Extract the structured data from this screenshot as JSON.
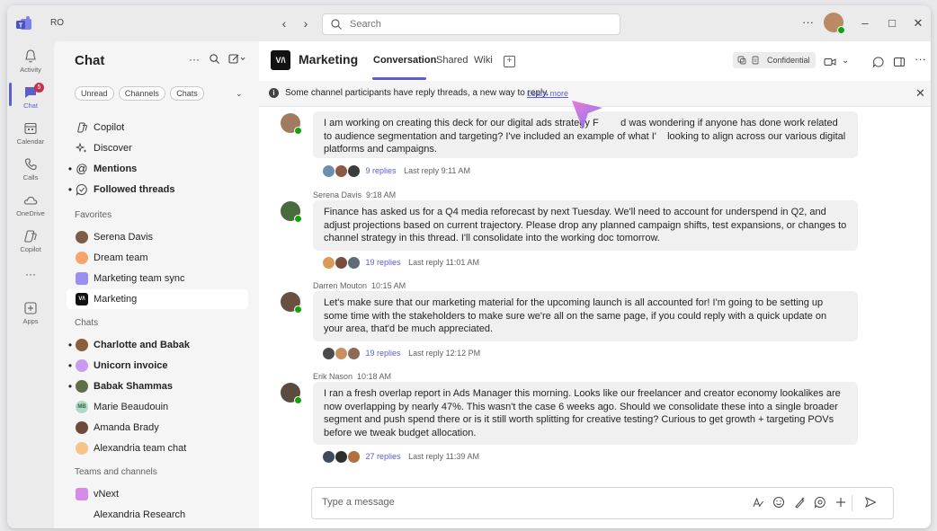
{
  "titlebar": {
    "org_label": "RO",
    "search_placeholder": "Search",
    "more": "···"
  },
  "rail": {
    "items": [
      {
        "label": "Activity"
      },
      {
        "label": "Chat",
        "badge": "5"
      },
      {
        "label": "Calendar"
      },
      {
        "label": "Calls"
      },
      {
        "label": "OneDrive"
      },
      {
        "label": "Copilot"
      },
      {
        "label": "···"
      },
      {
        "label": "Apps"
      }
    ]
  },
  "chatlist": {
    "title": "Chat",
    "filters": [
      "Unread",
      "Channels",
      "Chats"
    ],
    "top_items": [
      {
        "label": "Copilot",
        "icon": "copilot-icon"
      },
      {
        "label": "Discover",
        "icon": "sparkle-icon"
      },
      {
        "label": "Mentions",
        "icon": "at-icon"
      },
      {
        "label": "Followed threads",
        "icon": "threads-icon"
      }
    ],
    "favorites_header": "Favorites",
    "favorites": [
      {
        "label": "Serena Davis"
      },
      {
        "label": "Dream team"
      },
      {
        "label": "Marketing team sync"
      },
      {
        "label": "Marketing"
      }
    ],
    "chats_header": "Chats",
    "chats": [
      {
        "label": "Charlotte and Babak"
      },
      {
        "label": "Unicorn invoice"
      },
      {
        "label": "Babak Shammas"
      },
      {
        "label": "Marie Beaudouin",
        "initials": "MB"
      },
      {
        "label": "Amanda Brady"
      },
      {
        "label": "Alexandria team chat"
      }
    ],
    "teams_header": "Teams and channels",
    "teams": [
      {
        "label": "vNext"
      },
      {
        "label": "Alexandria Research"
      }
    ]
  },
  "channel": {
    "logo_text": "V/\\",
    "name": "Marketing",
    "tabs": [
      "Conversation",
      "Shared",
      "Wiki"
    ],
    "sensitivity": "Confidential",
    "banner_text": "Some channel participants have reply threads, a new way to reply.",
    "banner_link": "Learn more"
  },
  "messages": [
    {
      "author": "",
      "time": "",
      "text": "I am working on creating this deck for our digital ads strategy F        d was wondering if anyone has done work related to audience segmentation and targeting? I've included an example of what I'    looking to align across our various digital platforms and campaigns.",
      "replies": "9 replies",
      "last_reply": "Last reply 9:11 AM"
    },
    {
      "author": "Serena Davis",
      "time": "9:18 AM",
      "text": "Finance has asked us for a Q4 media reforecast by next Tuesday. We'll need to account for underspend in Q2, and adjust projections based on current trajectory. Please drop any planned campaign shifts, test expansions, or changes to channel strategy in this thread. I'll consolidate into the working doc tomorrow.",
      "replies": "19 replies",
      "last_reply": "Last reply 11:01 AM"
    },
    {
      "author": "Darren Mouton",
      "time": "10:15 AM",
      "text": "Let's make sure that our marketing material for the upcoming launch is all accounted for! I'm going to be setting up some time with the stakeholders to make sure we're all on the same page, if you could reply with a quick update on your area, that'd be much appreciated.",
      "replies": "19 replies",
      "last_reply": "Last reply 12:12 PM"
    },
    {
      "author": "Erik Nason",
      "time": "10:18 AM",
      "text": "I ran a fresh overlap report in Ads Manager this morning. Looks like our freelancer and creator economy lookalikes are now overlapping by nearly 47%. This wasn't the case 6 weeks ago. Should we consolidate these into a single broader segment and push spend there or is it still worth splitting for creative testing? Curious to get growth + targeting POVs before we tweak budget allocation.",
      "replies": "27 replies",
      "last_reply": "Last reply 11:39 AM"
    }
  ],
  "compose": {
    "placeholder": "Type a message"
  },
  "colors": {
    "brand": "#5b5fc7",
    "presence": "#13a10e",
    "badge": "#c4314b"
  }
}
